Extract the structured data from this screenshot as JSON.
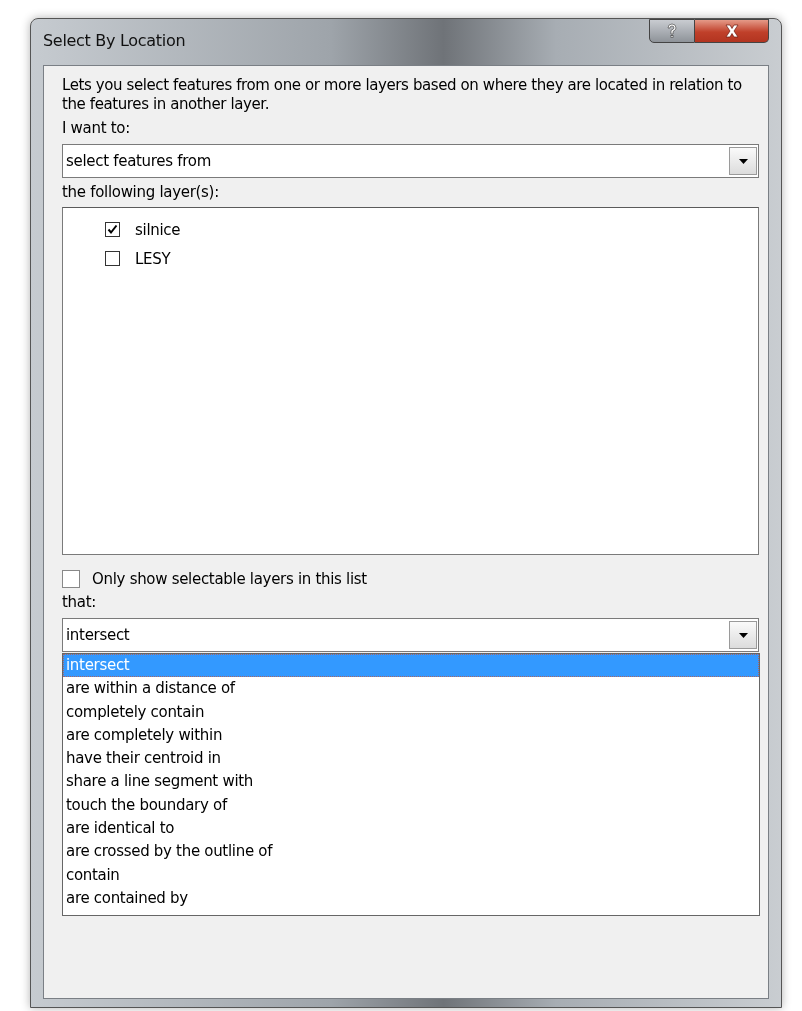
{
  "window": {
    "title": "Select By Location"
  },
  "description": "Lets you select features from one or more layers based on where they are located in relation to the features in another layer.",
  "method": {
    "label": "I want to:",
    "value": "select features from"
  },
  "layers": {
    "label": "the following layer(s):",
    "items": [
      {
        "name": "silnice",
        "checked": true
      },
      {
        "name": "LESY",
        "checked": false
      }
    ]
  },
  "only_selectable": {
    "label": "Only show selectable layers in this list",
    "checked": false
  },
  "relation": {
    "label": "that:",
    "value": "intersect",
    "options": [
      {
        "label": "intersect",
        "selected": true
      },
      {
        "label": "are within a distance of",
        "selected": false
      },
      {
        "label": "completely contain",
        "selected": false
      },
      {
        "label": "are completely within",
        "selected": false
      },
      {
        "label": "have their centroid in",
        "selected": false
      },
      {
        "label": "share a line segment with",
        "selected": false
      },
      {
        "label": "touch the boundary of",
        "selected": false
      },
      {
        "label": "are identical to",
        "selected": false
      },
      {
        "label": "are crossed by the outline of",
        "selected": false
      },
      {
        "label": "contain",
        "selected": false
      },
      {
        "label": "are contained by",
        "selected": false
      }
    ]
  }
}
